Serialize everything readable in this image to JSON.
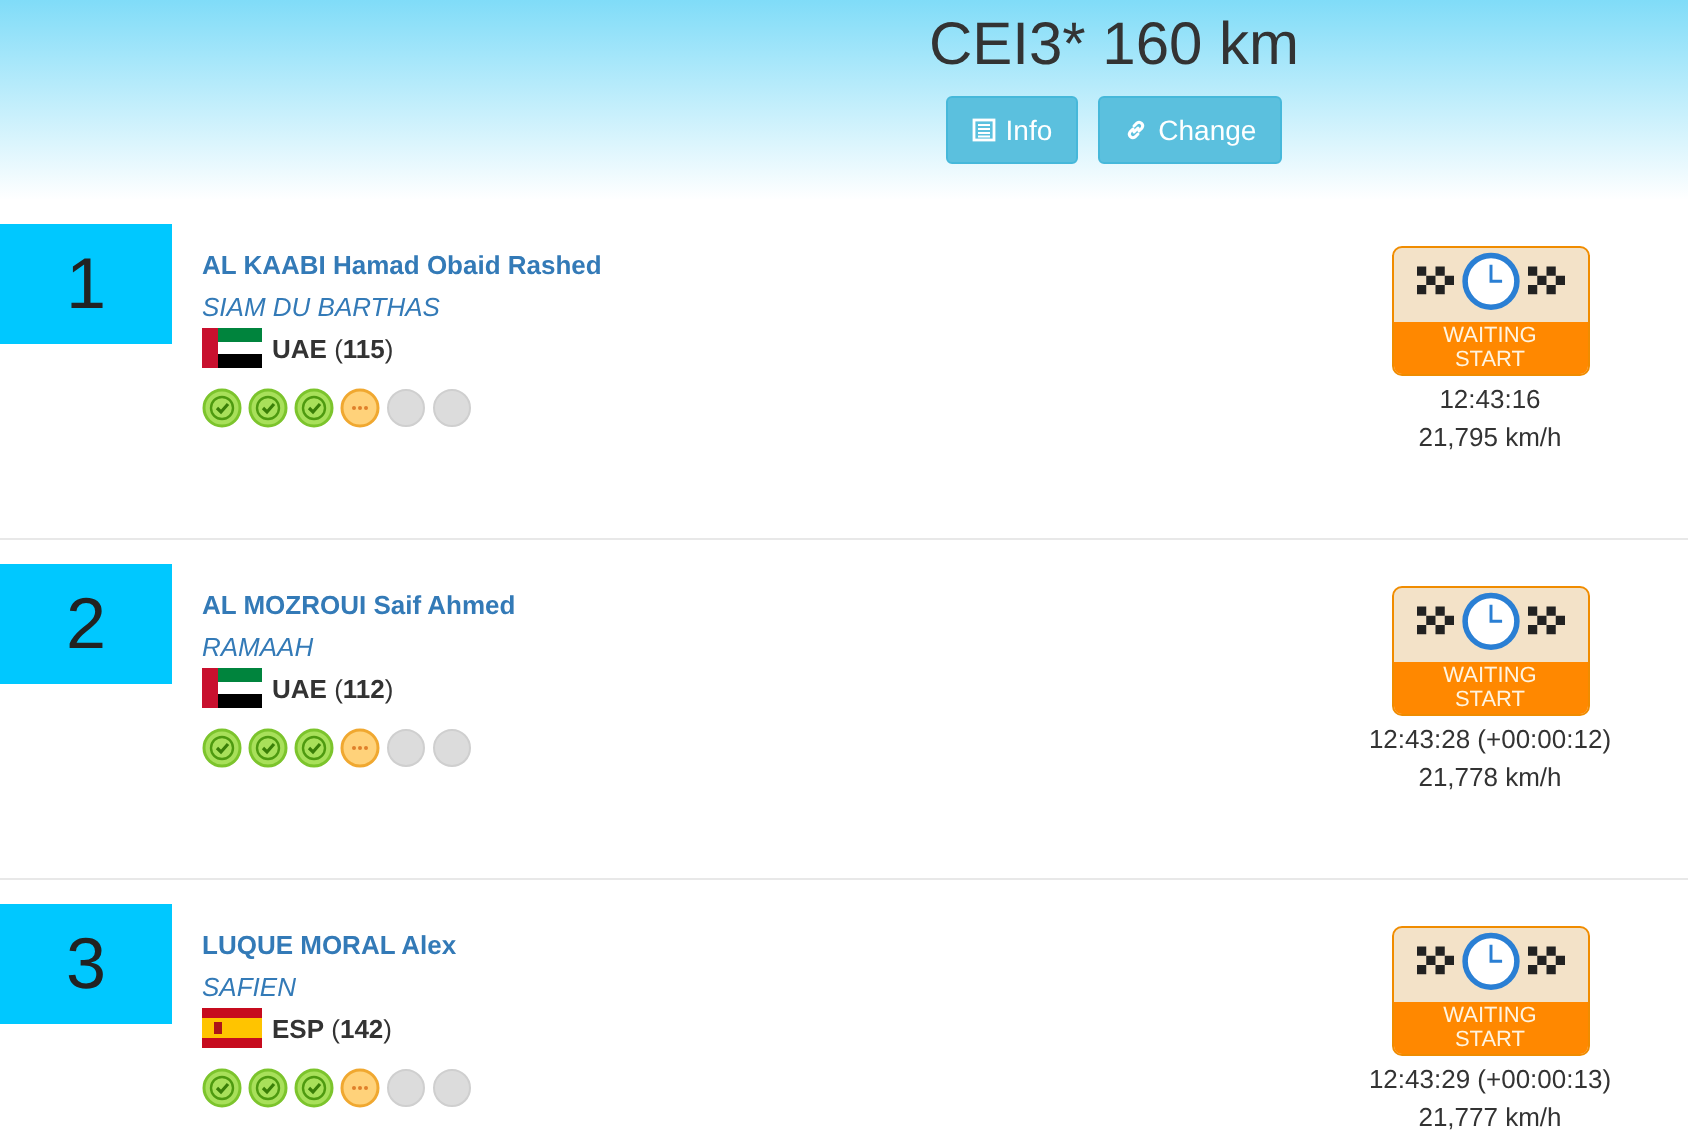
{
  "header": {
    "title": "CEI3* 160 km",
    "buttons": [
      {
        "label": "Info"
      },
      {
        "label": "Change"
      }
    ]
  },
  "riders": [
    {
      "rank": "1",
      "name": "AL KAABI Hamad Obaid Rashed",
      "horse": "SIAM DU BARTHAS",
      "nation": {
        "kind": "uae",
        "label": "**UAE** (**115**)"
      },
      "stages": [
        {
          "kind": "done"
        },
        {
          "kind": "done"
        },
        {
          "kind": "done"
        },
        {
          "kind": "current"
        },
        {
          "kind": "pending"
        },
        {
          "kind": "pending"
        }
      ],
      "status": "WAITING START",
      "time": "12:43:16",
      "speed": "21,795 km/h"
    },
    {
      "rank": "2",
      "name": "AL MOZROUI Saif Ahmed",
      "horse": "RAMAAH",
      "nation": {
        "kind": "uae",
        "label": "**UAE** (**112**)"
      },
      "stages": [
        {
          "kind": "done"
        },
        {
          "kind": "done"
        },
        {
          "kind": "done"
        },
        {
          "kind": "current"
        },
        {
          "kind": "pending"
        },
        {
          "kind": "pending"
        }
      ],
      "status": "WAITING START",
      "time": "12:43:28 (+00:00:12)",
      "speed": "21,778 km/h"
    },
    {
      "rank": "3",
      "name": "LUQUE MORAL Alex",
      "horse": "SAFIEN",
      "nation": {
        "kind": "esp",
        "label": "**ESP** (**142**)"
      },
      "stages": [
        {
          "kind": "done"
        },
        {
          "kind": "done"
        },
        {
          "kind": "done"
        },
        {
          "kind": "current"
        },
        {
          "kind": "pending"
        },
        {
          "kind": "pending"
        }
      ],
      "status": "WAITING START",
      "time": "12:43:29 (+00:00:13)",
      "speed": "21,777 km/h"
    }
  ]
}
